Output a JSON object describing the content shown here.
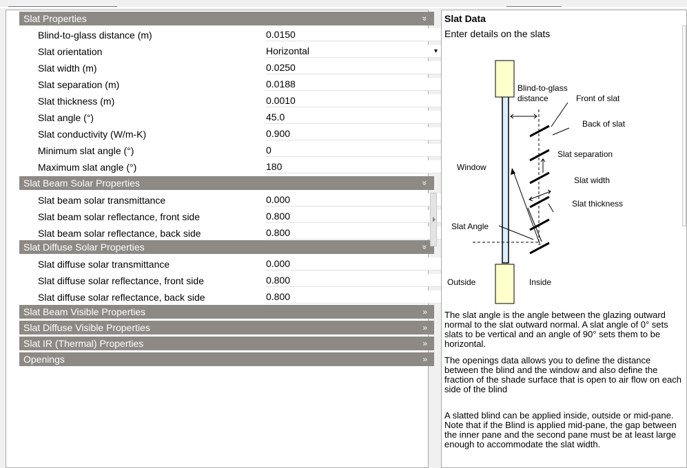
{
  "sections": [
    {
      "label": "Slat Properties",
      "chevron": "»"
    },
    {
      "label": "Slat Beam Solar Properties",
      "chevron": "»"
    },
    {
      "label": "Slat Diffuse Solar Properties",
      "chevron": "»"
    },
    {
      "label": "Slat Beam Visible Properties",
      "chevron": "»"
    },
    {
      "label": "Slat Diffuse Visible Properties",
      "chevron": "»"
    },
    {
      "label": "Slat IR (Thermal) Properties",
      "chevron": "»"
    },
    {
      "label": "Openings",
      "chevron": "»"
    }
  ],
  "slat_properties": [
    {
      "label": "Blind-to-glass distance (m)",
      "value": "0.0150"
    },
    {
      "label": "Slat orientation",
      "value": "Horizontal",
      "dropdown": "▾"
    },
    {
      "label": "Slat width (m)",
      "value": "0.0250"
    },
    {
      "label": "Slat separation (m)",
      "value": "0.0188"
    },
    {
      "label": "Slat thickness (m)",
      "value": "0.0010"
    },
    {
      "label": "Slat angle (°)",
      "value": "45.0"
    },
    {
      "label": "Slat conductivity (W/m-K)",
      "value": "0.900"
    },
    {
      "label": "Minimum slat angle (°)",
      "value": "0"
    },
    {
      "label": "Maximum slat angle (°)",
      "value": "180"
    }
  ],
  "beam_solar": [
    {
      "label": "Slat beam solar transmittance",
      "value": "0.000"
    },
    {
      "label": "Slat beam solar reflectance, front side",
      "value": "0.800"
    },
    {
      "label": "Slat beam solar reflectance, back side",
      "value": "0.800"
    }
  ],
  "diffuse_solar": [
    {
      "label": "Slat diffuse solar transmittance",
      "value": "0.000"
    },
    {
      "label": "Slat diffuse solar reflectance, front side",
      "value": "0.800"
    },
    {
      "label": "Slat diffuse solar reflectance, back side",
      "value": "0.800"
    }
  ],
  "help": {
    "title": "Slat Data",
    "subtitle": "Enter details on the slats",
    "diagram_labels": {
      "blind_to_glass": "Blind-to-glass",
      "distance": "distance",
      "front_of_slat": "Front of slat",
      "back_of_slat": "Back of slat",
      "slat_separation": "Slat separation",
      "window": "Window",
      "slat_width": "Slat width",
      "slat_thickness": "Slat thickness",
      "slat_angle": "Slat Angle",
      "outside": "Outside",
      "inside": "Inside"
    },
    "paragraph1": "The slat angle is the angle between the glazing outward normal to the slat outward normal.  A slat angle of 0° sets slats to be vertical and an angle of 90° sets them to be horizontal.",
    "paragraph2": "The openings data allows you to define the distance between the blind and the window and also define the fraction of the shade surface that is open to air flow on each side of the blind",
    "paragraph3": "A slatted blind can be applied inside, outside or mid-pane. Note that if the Blind is applied mid-pane, the gap between the inner pane and the second pane must be at least large enough to accommodate the slat width."
  }
}
